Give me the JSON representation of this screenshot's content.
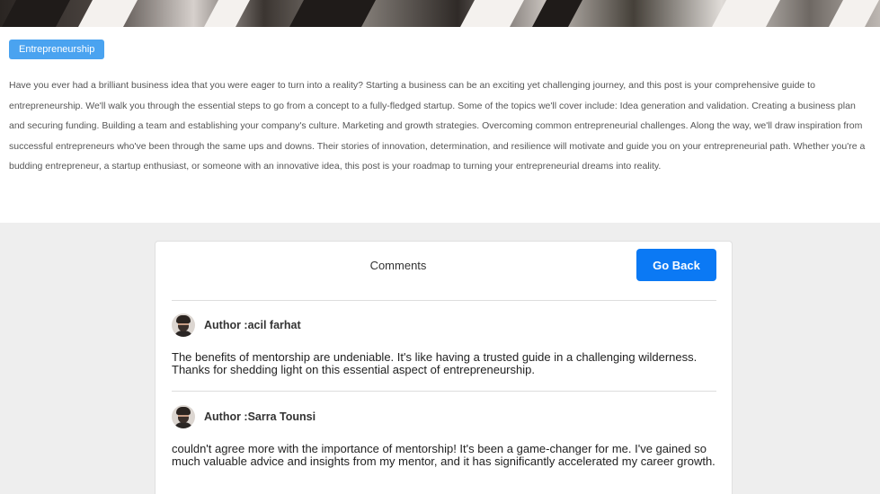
{
  "post": {
    "tag": "Entrepreneurship",
    "body": "Have you ever had a brilliant business idea that you were eager to turn into a reality? Starting a business can be an exciting yet challenging journey, and this post is your comprehensive guide to entrepreneurship. We'll walk you through the essential steps to go from a concept to a fully-fledged startup. Some of the topics we'll cover include: Idea generation and validation. Creating a business plan and securing funding. Building a team and establishing your company's culture. Marketing and growth strategies. Overcoming common entrepreneurial challenges. Along the way, we'll draw inspiration from successful entrepreneurs who've been through the same ups and downs. Their stories of innovation, determination, and resilience will motivate and guide you on your entrepreneurial path. Whether you're a budding entrepreneur, a startup enthusiast, or someone with an innovative idea, this post is your roadmap to turning your entrepreneurial dreams into reality."
  },
  "comments": {
    "title": "Comments",
    "go_back_label": "Go Back",
    "items": [
      {
        "author": "Author :acil farhat",
        "text": "The benefits of mentorship are undeniable. It's like having a trusted guide in a challenging wilderness. Thanks for shedding light on this essential aspect of entrepreneurship."
      },
      {
        "author": "Author :Sarra Tounsi",
        "text": "couldn't agree more with the importance of mentorship! It's been a game-changer for me. I've gained so much valuable advice and insights from my mentor, and it has significantly accelerated my career growth."
      }
    ]
  },
  "colors": {
    "tag_bg": "#4aa3f0",
    "button_bg": "#0b79f4",
    "page_bg": "#eeeeee"
  },
  "icons": {
    "avatar": "user-avatar-photo"
  }
}
